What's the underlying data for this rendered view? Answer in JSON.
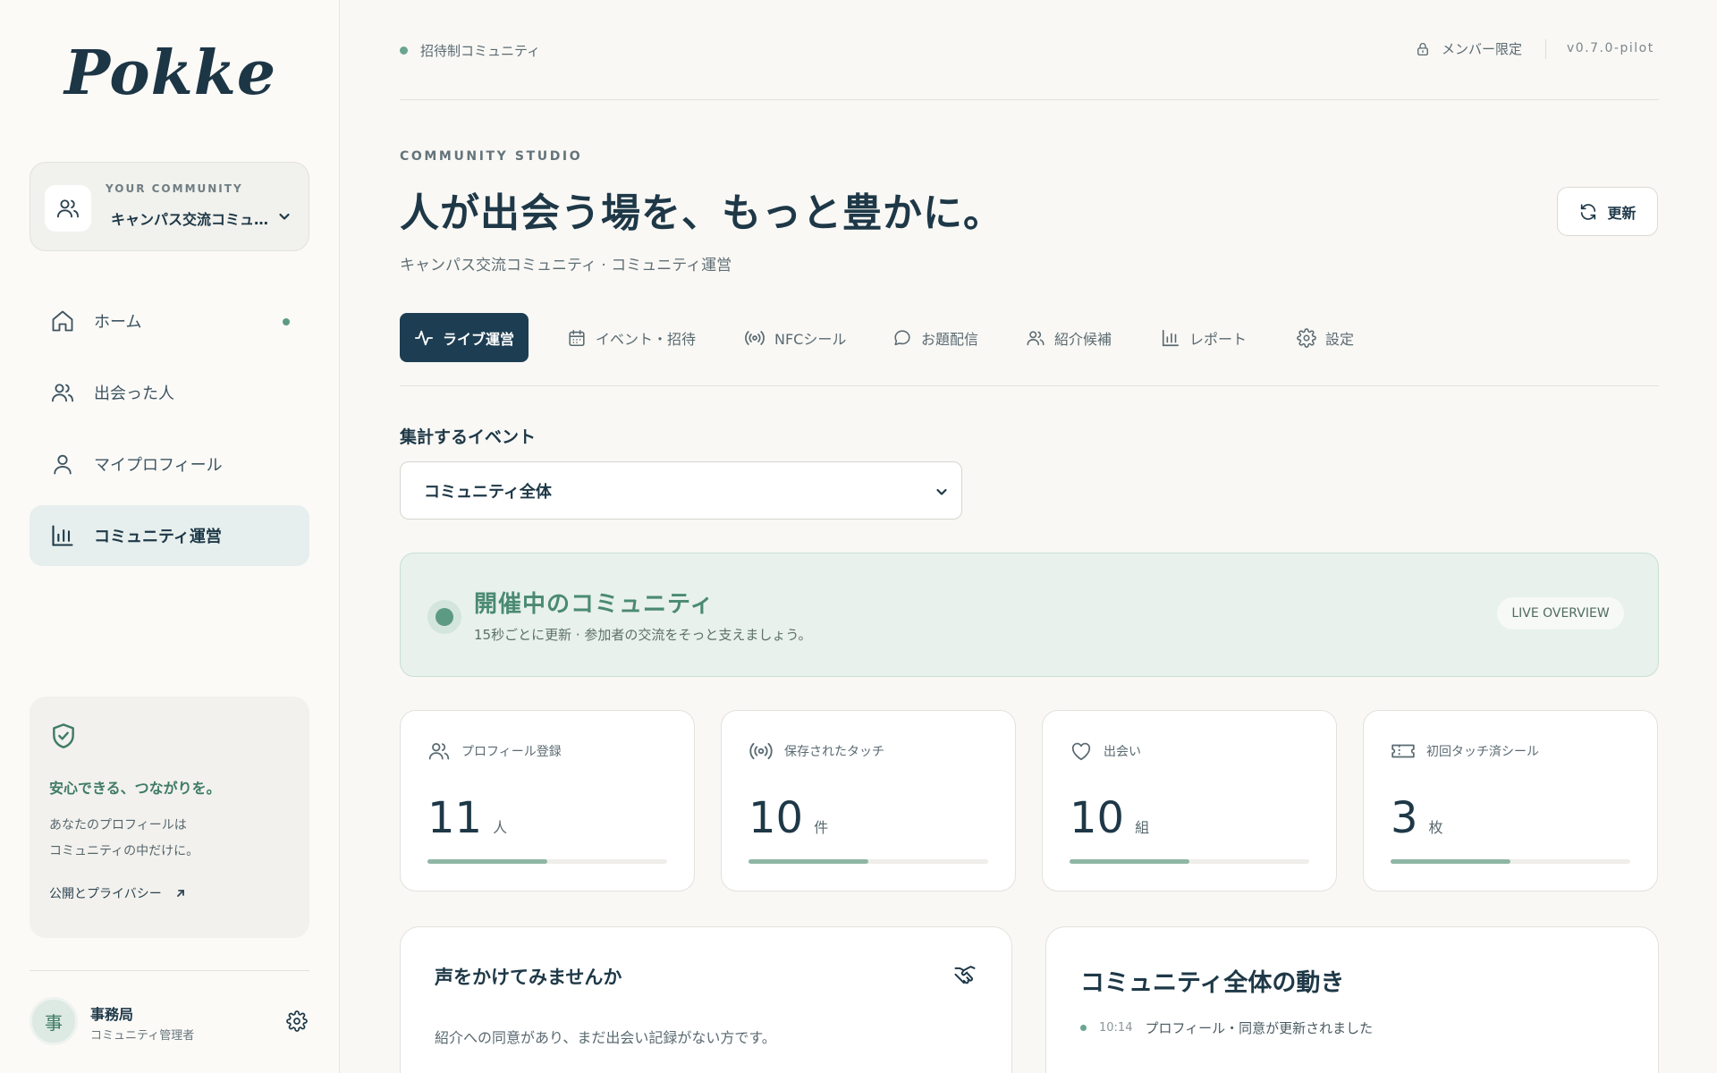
{
  "brand": {
    "logo": "Pokke"
  },
  "community": {
    "kicker": "YOUR COMMUNITY",
    "name": "キャンパス交流コミュニティ"
  },
  "nav": {
    "items": [
      {
        "label": "ホーム",
        "icon": "home-icon",
        "active": false,
        "dot": true
      },
      {
        "label": "出会った人",
        "icon": "users-icon",
        "active": false
      },
      {
        "label": "マイプロフィール",
        "icon": "user-icon",
        "active": false
      },
      {
        "label": "コミュニティ運営",
        "icon": "bar-chart-icon",
        "active": true
      }
    ]
  },
  "privacy": {
    "title": "安心できる、つながりを。",
    "body_line1": "あなたのプロフィールは",
    "body_line2": "コミュニティの中だけに。",
    "link": "公開とプライバシー"
  },
  "user": {
    "avatar": "事",
    "name": "事務局",
    "role": "コミュニティ管理者"
  },
  "topbar": {
    "invite": "招待制コミュニティ",
    "member_only": "メンバー限定",
    "version": "v0.7.0-pilot"
  },
  "header": {
    "kicker": "COMMUNITY STUDIO",
    "title": "人が出会う場を、もっと豊かに。",
    "subtitle": "キャンパス交流コミュニティ · コミュニティ運営",
    "refresh": "更新"
  },
  "tabs": [
    {
      "label": "ライブ運営",
      "icon": "activity-icon",
      "active": true
    },
    {
      "label": "イベント・招待",
      "icon": "calendar-icon"
    },
    {
      "label": "NFCシール",
      "icon": "nfc-icon"
    },
    {
      "label": "お題配信",
      "icon": "chat-bubble-icon"
    },
    {
      "label": "紹介候補",
      "icon": "users-icon"
    },
    {
      "label": "レポート",
      "icon": "bar-chart-icon"
    },
    {
      "label": "設定",
      "icon": "gear-icon"
    }
  ],
  "aggregate": {
    "label": "集計するイベント",
    "selected": "コミュニティ全体"
  },
  "live": {
    "title": "開催中のコミュニティ",
    "subtitle": "15秒ごとに更新 · 参加者の交流をそっと支えましょう。",
    "pill": "LIVE OVERVIEW"
  },
  "stats": [
    {
      "label": "プロフィール登録",
      "value": "11",
      "unit": "人",
      "icon": "users-icon",
      "progress": 0.5
    },
    {
      "label": "保存されたタッチ",
      "value": "10",
      "unit": "件",
      "icon": "nfc-icon",
      "progress": 0.5
    },
    {
      "label": "出会い",
      "value": "10",
      "unit": "組",
      "icon": "heart-icon",
      "progress": 0.5
    },
    {
      "label": "初回タッチ済シール",
      "value": "3",
      "unit": "枚",
      "icon": "ticket-icon",
      "progress": 0.5
    }
  ],
  "suggest": {
    "title": "声をかけてみませんか",
    "body": "紹介への同意があり、まだ出会い記録がない方です。"
  },
  "activity": {
    "title": "コミュニティ全体の動き",
    "items": [
      {
        "time": "10:14",
        "text": "プロフィール・同意が更新されました"
      }
    ]
  },
  "colors": {
    "primary": "#1d3e52",
    "accent": "#5d9a83",
    "live_bg": "#e8f1ec",
    "progress": "#8fb6a5"
  }
}
